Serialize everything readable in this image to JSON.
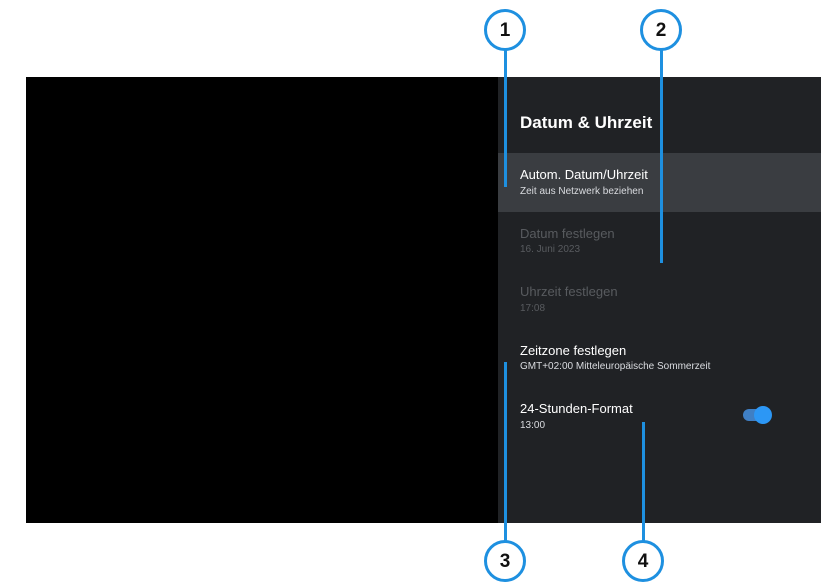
{
  "colors": {
    "page_bg": "#ffffff",
    "annotation": "#1e90e0",
    "screen_bg": "#000000",
    "panel_bg": "#202225",
    "focused_row_bg": "#3a3d41",
    "text_primary": "#ffffff",
    "text_secondary": "#dadce0",
    "text_disabled": "#585b5f",
    "toggle_track": "#3f7fc4",
    "toggle_thumb": "#2c97f5",
    "badge_text": "#111111"
  },
  "callouts": [
    {
      "number": "1"
    },
    {
      "number": "2"
    },
    {
      "number": "3"
    },
    {
      "number": "4"
    }
  ],
  "panel": {
    "title": "Datum & Uhrzeit",
    "items": [
      {
        "title": "Autom. Datum/Uhrzeit",
        "subtitle": "Zeit aus Netzwerk beziehen",
        "enabled": true,
        "focused": true
      },
      {
        "title": "Datum festlegen",
        "subtitle": "16. Juni 2023",
        "enabled": false,
        "focused": false
      },
      {
        "title": "Uhrzeit festlegen",
        "subtitle": "17:08",
        "enabled": false,
        "focused": false
      },
      {
        "title": "Zeitzone festlegen",
        "subtitle": "GMT+02:00 Mitteleuropäische Sommerzeit",
        "enabled": true,
        "focused": false
      },
      {
        "title": "24-Stunden-Format",
        "subtitle": "13:00",
        "enabled": true,
        "focused": false,
        "toggle": {
          "icon": "toggle-switch",
          "on": true
        }
      }
    ]
  }
}
